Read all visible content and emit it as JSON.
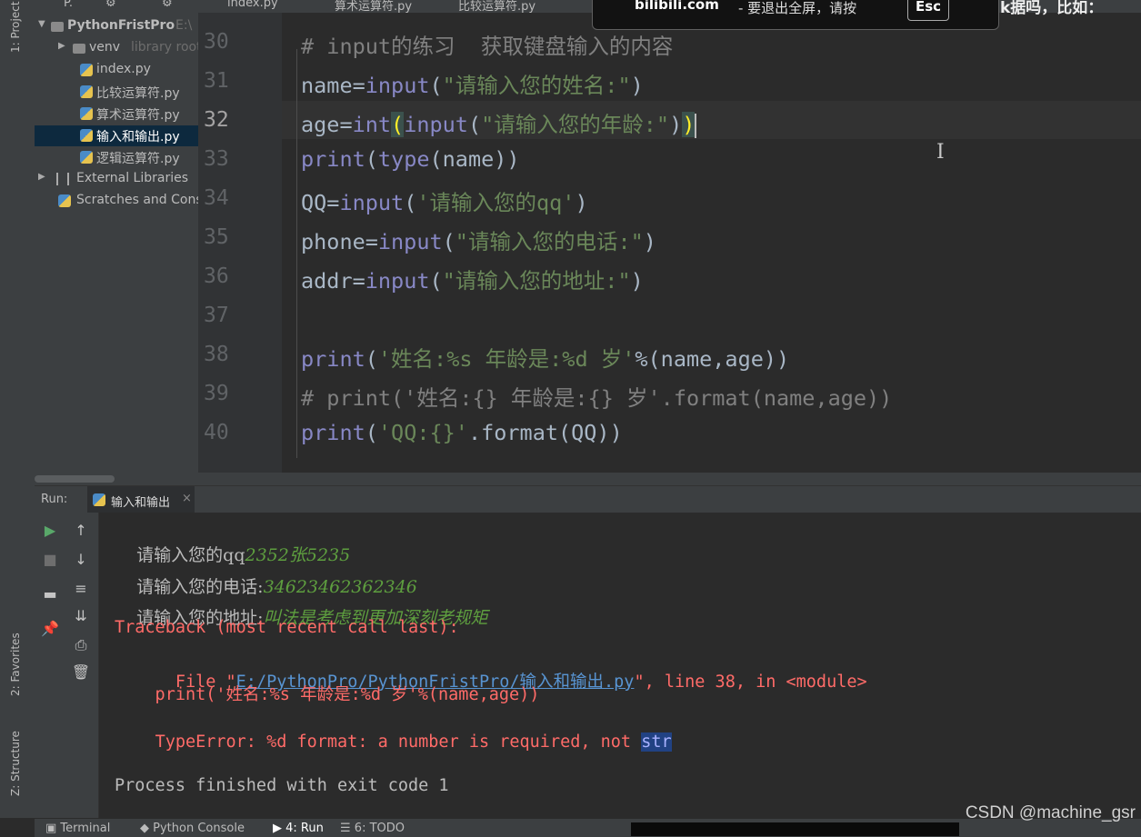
{
  "top_tabs": [
    "P.",
    "index.py",
    "算术运算符.py",
    "比较运算符.py"
  ],
  "notification": {
    "domain": "bilibili.com",
    "text": "- 要退出全屏，请按",
    "key": "Esc",
    "right_overflow": "k据吗，比如："
  },
  "left_strip": {
    "project": "1: Project",
    "favorites": "2: Favorites",
    "structure": "Z: Structure"
  },
  "project_tree": {
    "root": "PythonFristPro",
    "root_path": "E:\\",
    "venv": "venv",
    "venv_note": "library root",
    "files": [
      "index.py",
      "比较运算符.py",
      "算术运算符.py",
      "输入和输出.py",
      "逻辑运算符.py"
    ],
    "selected_file": "输入和输出.py",
    "external": "External Libraries",
    "scratches": "Scratches and Consoles"
  },
  "editor": {
    "line_numbers": [
      "30",
      "31",
      "32",
      "33",
      "34",
      "35",
      "36",
      "37",
      "38",
      "39",
      "40"
    ],
    "current_line": "32"
  },
  "run_panel": {
    "label": "Run:",
    "tab_name": "输入和输出",
    "console": {
      "prompt_qq": "请输入您的qq",
      "input_qq": "2352张5235",
      "prompt_phone": "请输入您的电话:",
      "input_phone": "34623462362346",
      "prompt_addr": "请输入您的地址:",
      "input_addr": "叫法是考虑到更加深刻老规矩",
      "traceback_head": "Traceback (most recent call last):",
      "file_prefix": "  File \"",
      "file_path": "E:/PythonPro/PythonFristPro/输入和输出.py",
      "file_suffix": "\", line 38, in <module>",
      "error_src": "    print('姓名:%s 年龄是:%d 岁'%(name,age))",
      "error_msg": "TypeError: %d format: a number is required, not ",
      "error_sel": "str",
      "finished": "Process finished with exit code 1"
    }
  },
  "bottom_tabs": {
    "terminal": "Terminal",
    "python_console": "Python Console",
    "run": "4: Run",
    "todo": "6: TODO"
  },
  "watermark": "CSDN @machine_gsr",
  "colors": {
    "editor_bg": "#2b2b2b",
    "panel_bg": "#3c3f41",
    "keyword": "#8888c6",
    "string": "#6a8759",
    "comment": "#808080",
    "error": "#ff6b68",
    "link": "#5894d2",
    "console_input": "#5e9f3f"
  }
}
